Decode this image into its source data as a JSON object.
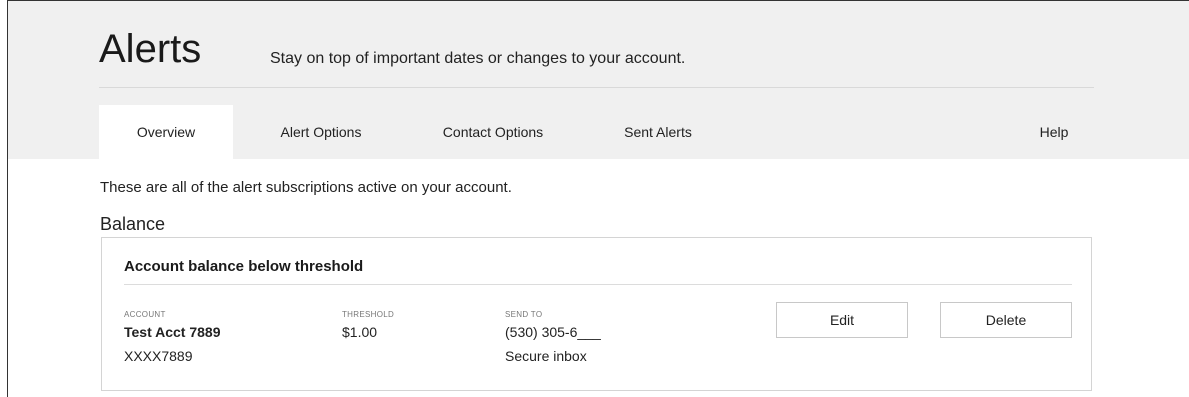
{
  "page": {
    "title": "Alerts",
    "subtitle": "Stay on top of important dates or changes to your account."
  },
  "tabs": [
    {
      "label": "Overview",
      "active": true
    },
    {
      "label": "Alert Options",
      "active": false
    },
    {
      "label": "Contact Options",
      "active": false
    },
    {
      "label": "Sent Alerts",
      "active": false
    }
  ],
  "help_label": "Help",
  "intro_text": "These are all of the alert subscriptions active on your account.",
  "sections": [
    {
      "heading": "Balance",
      "alerts": [
        {
          "title": "Account balance below threshold",
          "account": {
            "label": "ACCOUNT",
            "name": "Test Acct 7889",
            "number": "XXXX7889"
          },
          "threshold": {
            "label": "THRESHOLD",
            "value": "$1.00"
          },
          "send_to": {
            "label": "SEND TO",
            "phone": "(530) 305-6___",
            "inbox": "Secure inbox"
          },
          "edit_label": "Edit",
          "delete_label": "Delete"
        }
      ]
    }
  ],
  "colors": {
    "header_background": "#f0f0f0",
    "border": "#d4d4d4"
  }
}
